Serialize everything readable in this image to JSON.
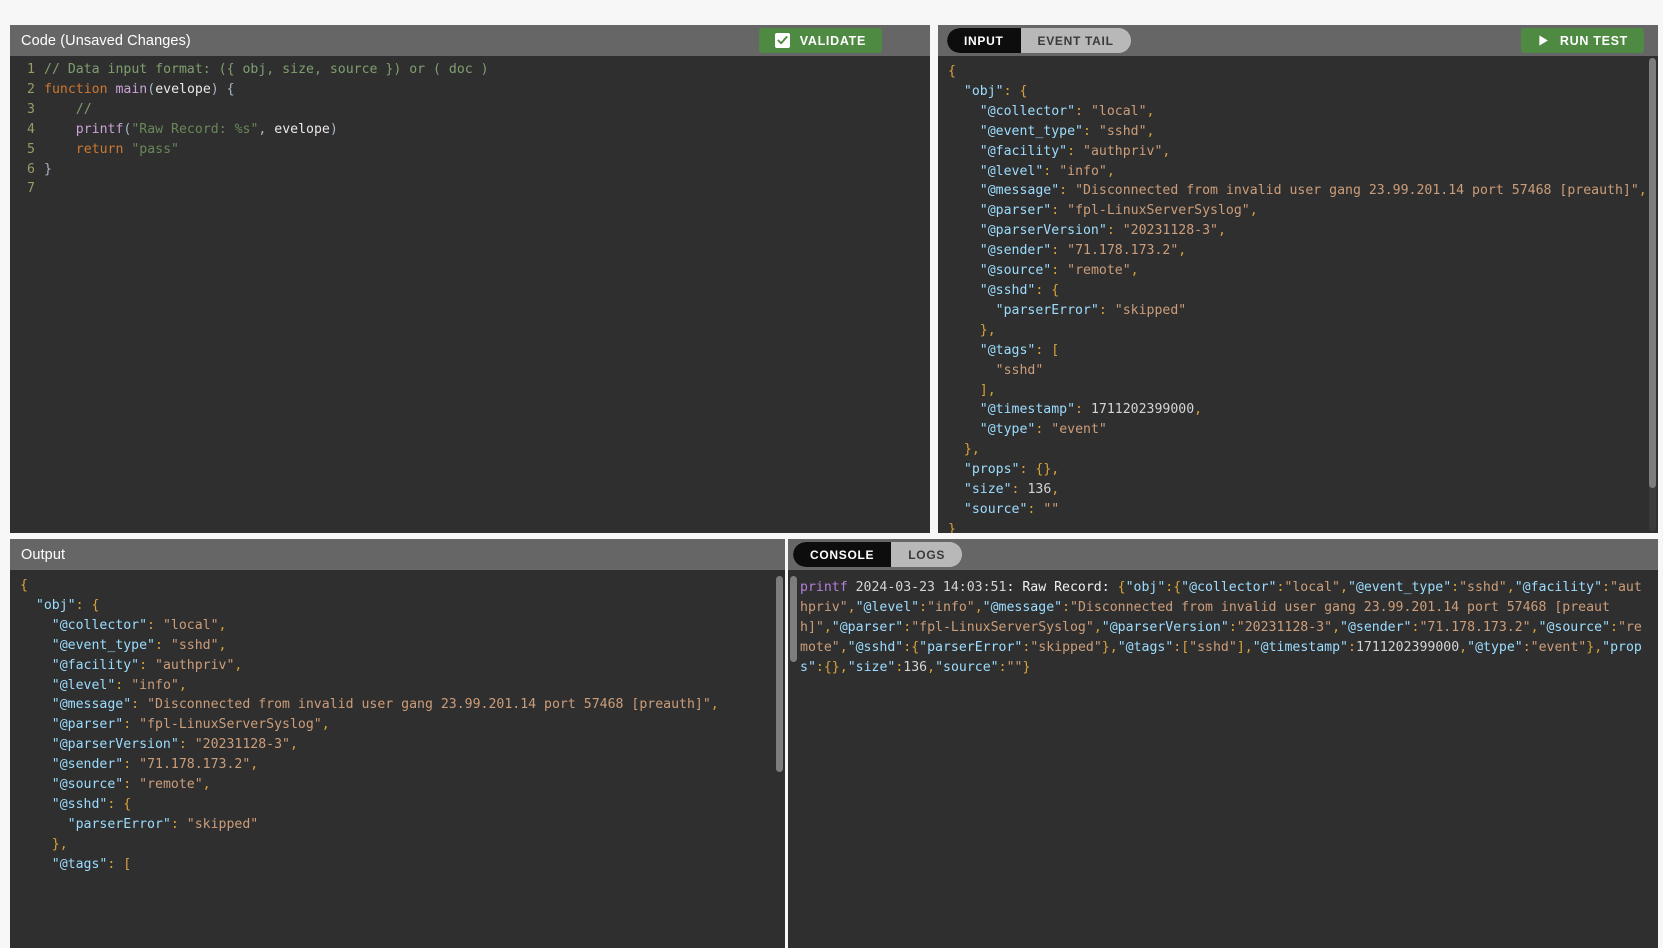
{
  "code_panel": {
    "title": "Code (Unsaved Changes)",
    "validate_label": "VALIDATE",
    "lines": [
      {
        "n": "1",
        "tokens": [
          {
            "t": "com",
            "s": "// Data input format: ({ obj, size, source }) or ( doc )"
          }
        ]
      },
      {
        "n": "2",
        "tokens": [
          {
            "t": "kw",
            "s": "function "
          },
          {
            "t": "fn",
            "s": "main"
          },
          {
            "t": "punc",
            "s": "("
          },
          {
            "t": "var",
            "s": "evelope"
          },
          {
            "t": "punc",
            "s": ") {"
          }
        ]
      },
      {
        "n": "3",
        "tokens": [
          {
            "t": "com",
            "s": "    //"
          }
        ]
      },
      {
        "n": "4",
        "tokens": [
          {
            "t": "plain",
            "s": "    "
          },
          {
            "t": "fn",
            "s": "printf"
          },
          {
            "t": "punc",
            "s": "("
          },
          {
            "t": "str",
            "s": "\"Raw Record: %s\""
          },
          {
            "t": "punc",
            "s": ", "
          },
          {
            "t": "var",
            "s": "evelope"
          },
          {
            "t": "punc",
            "s": ")"
          }
        ]
      },
      {
        "n": "5",
        "tokens": [
          {
            "t": "plain",
            "s": "    "
          },
          {
            "t": "kw",
            "s": "return "
          },
          {
            "t": "str",
            "s": "\"pass\""
          }
        ]
      },
      {
        "n": "6",
        "tokens": [
          {
            "t": "punc",
            "s": "}"
          }
        ]
      },
      {
        "n": "7",
        "tokens": [
          {
            "t": "plain",
            "s": ""
          }
        ]
      }
    ]
  },
  "input_panel": {
    "tabs": [
      {
        "label": "INPUT",
        "active": true
      },
      {
        "label": "EVENT TAIL",
        "active": false
      }
    ],
    "run_test_label": "RUN TEST",
    "json_text": "{\n  \"obj\": {\n    \"@collector\": \"local\",\n    \"@event_type\": \"sshd\",\n    \"@facility\": \"authpriv\",\n    \"@level\": \"info\",\n    \"@message\": \"Disconnected from invalid user gang 23.99.201.14 port 57468 [preauth]\",\n    \"@parser\": \"fpl-LinuxServerSyslog\",\n    \"@parserVersion\": \"20231128-3\",\n    \"@sender\": \"71.178.173.2\",\n    \"@source\": \"remote\",\n    \"@sshd\": {\n      \"parserError\": \"skipped\"\n    },\n    \"@tags\": [\n      \"sshd\"\n    ],\n    \"@timestamp\": 1711202399000,\n    \"@type\": \"event\"\n  },\n  \"props\": {},\n  \"size\": 136,\n  \"source\": \"\"\n}"
  },
  "output_panel": {
    "title": "Output",
    "json_text": "{\n  \"obj\": {\n    \"@collector\": \"local\",\n    \"@event_type\": \"sshd\",\n    \"@facility\": \"authpriv\",\n    \"@level\": \"info\",\n    \"@message\": \"Disconnected from invalid user gang 23.99.201.14 port 57468 [preauth]\",\n    \"@parser\": \"fpl-LinuxServerSyslog\",\n    \"@parserVersion\": \"20231128-3\",\n    \"@sender\": \"71.178.173.2\",\n    \"@source\": \"remote\",\n    \"@sshd\": {\n      \"parserError\": \"skipped\"\n    },\n    \"@tags\": ["
  },
  "console_panel": {
    "tabs": [
      {
        "label": "CONSOLE",
        "active": true
      },
      {
        "label": "LOGS",
        "active": false
      }
    ],
    "log_command": "printf",
    "log_date": "2024-03-23",
    "log_time": "14:03:51",
    "log_prefix": ": Raw Record: ",
    "log_payload": "{\"obj\":{\"@collector\":\"local\",\"@event_type\":\"sshd\",\"@facility\":\"authpriv\",\"@level\":\"info\",\"@message\":\"Disconnected from invalid user gang 23.99.201.14 port 57468 [preauth]\",\"@parser\":\"fpl-LinuxServerSyslog\",\"@parserVersion\":\"20231128-3\",\"@sender\":\"71.178.173.2\",\"@source\":\"remote\",\"@sshd\":{\"parserError\":\"skipped\"},\"@tags\":[\"sshd\"],\"@timestamp\":1711202399000,\"@type\":\"event\"},\"props\":{},\"size\":136,\"source\":\"\"}"
  },
  "colors": {
    "accent_green": "#4f8a43",
    "panel_header": "#666666",
    "editor_bg": "#2f2f2f",
    "page_bg": "#f7f7f7",
    "tab_active": "#0d0d0d",
    "tab_inactive": "#b8b8b8"
  }
}
